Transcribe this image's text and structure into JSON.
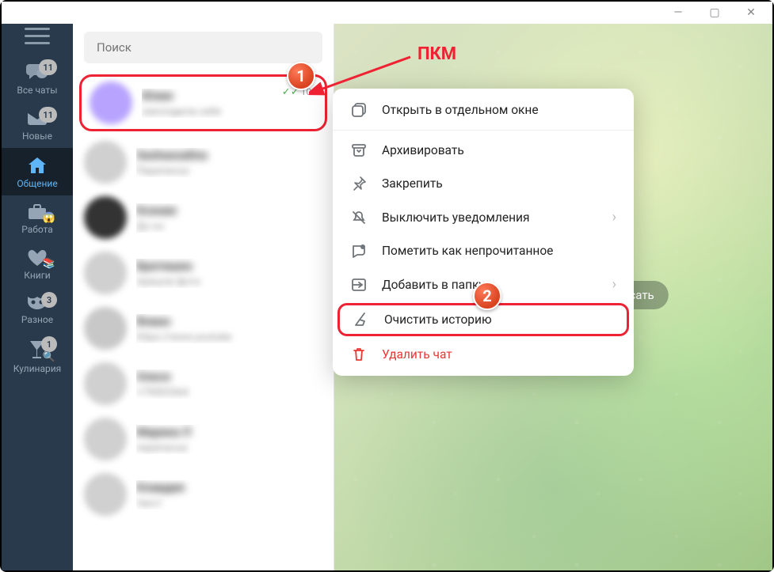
{
  "titlebar": {
    "min": "—",
    "max": "▢",
    "close": "✕"
  },
  "sidebar": {
    "menu": "menu",
    "folders": [
      {
        "icon": "chat",
        "label": "Все чаты",
        "badge": "11"
      },
      {
        "icon": "new",
        "label": "Новые",
        "badge": "11"
      },
      {
        "icon": "home",
        "label": "Общение",
        "active": true
      },
      {
        "icon": "briefcase",
        "label": "Работа",
        "emoji": "😱"
      },
      {
        "icon": "heart",
        "label": "Книги",
        "emoji": "📚"
      },
      {
        "icon": "mask",
        "label": "Разное",
        "badge": "3"
      },
      {
        "icon": "cocktail",
        "label": "Кулинария",
        "badge": "1",
        "emoji": "🔍"
      }
    ]
  },
  "search": {
    "placeholder": "Поиск"
  },
  "chats": [
    {
      "name": "Юлия",
      "preview": "омолодила себя",
      "time": "10:",
      "checks": true,
      "avatar_color": "#b8a4ff",
      "selected": true
    },
    {
      "name": "Sashaxoalina",
      "preview": "Переписка",
      "time": "",
      "avatar_color": "#d0d0d0"
    },
    {
      "name": "Ксения",
      "preview": "До кн",
      "time": "",
      "avatar_color": "#333"
    },
    {
      "name": "Братишка",
      "preview": "пришли фото",
      "time": "",
      "checks": true,
      "avatar_color": "#d0d0d0"
    },
    {
      "name": "Вован",
      "preview": "https://www.youtube",
      "time": "",
      "checks": true,
      "avatar_color": "#c8c8c8"
    },
    {
      "name": "Олеся",
      "preview": "+79003364",
      "time": "",
      "checks": true,
      "avatar_color": "#d0d0d0"
    },
    {
      "name": "Марина Л",
      "preview": "переписка",
      "time": "",
      "avatar_color": "#d0d0d0"
    },
    {
      "name": "Клавдия",
      "preview": "текст",
      "time": "",
      "checks": true,
      "avatar_color": "#d0d0d0"
    }
  ],
  "context_menu": {
    "items": [
      {
        "icon": "window",
        "label": "Открыть в отдельном окне"
      },
      {
        "sep": true
      },
      {
        "icon": "archive",
        "label": "Архивировать"
      },
      {
        "icon": "pin",
        "label": "Закрепить"
      },
      {
        "icon": "mute",
        "label": "Выключить уведомления",
        "chevron": true
      },
      {
        "icon": "unread",
        "label": "Пометить как непрочитанное"
      },
      {
        "icon": "folder",
        "label": "Добавить в папку",
        "chevron": true
      },
      {
        "icon": "broom",
        "label": "Очистить историю",
        "highlighted": true
      },
      {
        "icon": "trash",
        "label": "Удалить чат",
        "danger": true
      }
    ]
  },
  "chat_area": {
    "placeholder": "Выберите, кому хотели бы написать"
  },
  "annotations": {
    "pkm": "ПКМ",
    "n1": "1",
    "n2": "2"
  }
}
